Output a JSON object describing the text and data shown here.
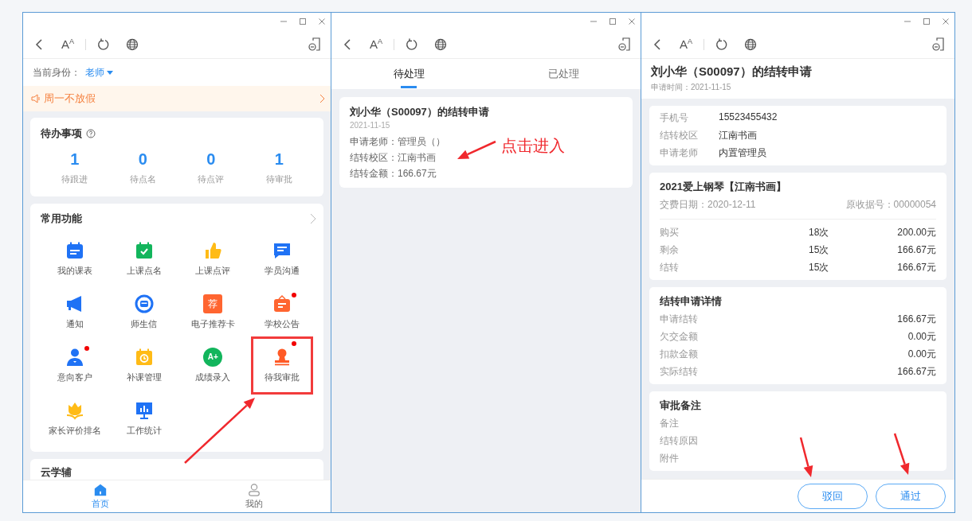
{
  "home_screen": {
    "toolbar": {
      "font_label": "A$^{A}$"
    },
    "identity": {
      "label": "当前身份：",
      "value": "老师"
    },
    "notice": "周一不放假",
    "todo": {
      "title": "待办事项",
      "items": [
        {
          "count": "1",
          "label": "待跟进"
        },
        {
          "count": "0",
          "label": "待点名"
        },
        {
          "count": "0",
          "label": "待点评"
        },
        {
          "count": "1",
          "label": "待审批"
        }
      ]
    },
    "functions": {
      "title": "常用功能",
      "items": [
        {
          "label": "我的课表",
          "kind": "calendar",
          "badge": false,
          "highlighted": false
        },
        {
          "label": "上课点名",
          "kind": "check-calendar",
          "badge": false,
          "highlighted": false
        },
        {
          "label": "上课点评",
          "kind": "thumb",
          "badge": false,
          "highlighted": false
        },
        {
          "label": "学员沟通",
          "kind": "chat",
          "badge": false,
          "highlighted": false
        },
        {
          "label": "通知",
          "kind": "megaphone",
          "badge": false,
          "highlighted": false
        },
        {
          "label": "师生信",
          "kind": "message",
          "badge": false,
          "highlighted": false
        },
        {
          "label": "电子推荐卡",
          "kind": "text-card",
          "icon_text": "荐",
          "badge": false,
          "highlighted": false
        },
        {
          "label": "学校公告",
          "kind": "board",
          "badge": true,
          "highlighted": false
        },
        {
          "label": "意向客户",
          "kind": "person",
          "badge": true,
          "highlighted": false
        },
        {
          "label": "补课管理",
          "kind": "clock-calendar",
          "badge": false,
          "highlighted": false
        },
        {
          "label": "成绩录入",
          "kind": "text-circle",
          "icon_text": "A+",
          "badge": false,
          "highlighted": false
        },
        {
          "label": "待我审批",
          "kind": "stamp",
          "badge": true,
          "highlighted": true
        },
        {
          "label": "家长评价排名",
          "kind": "tulip",
          "badge": false,
          "highlighted": false
        },
        {
          "label": "工作统计",
          "kind": "monitor",
          "badge": false,
          "highlighted": false
        }
      ]
    },
    "section_title": "云学辅",
    "bottom_nav": [
      {
        "label": "首页",
        "kind": "home",
        "selected": true
      },
      {
        "label": "我的",
        "kind": "user",
        "selected": false
      }
    ]
  },
  "approval_list_screen": {
    "toolbar": {
      "font_label": "A$^{A}$"
    },
    "tabs": [
      {
        "label": "待处理",
        "selected": true
      },
      {
        "label": "已处理",
        "selected": false
      }
    ],
    "card": {
      "title": "刘小华（S00097）的结转申请",
      "date": "2021-11-15",
      "lines": [
        "申请老师：管理员（）",
        "结转校区：江南书画",
        "结转金额：166.67元"
      ]
    },
    "annotation": "点击进入"
  },
  "detail_screen": {
    "toolbar": {
      "font_label": "A$^{A}$"
    },
    "title": "刘小华（S00097）的结转申请",
    "subtitle": "申请时间：2021-11-15",
    "info": [
      {
        "label": "手机号",
        "value": "15523455432"
      },
      {
        "label": "结转校区",
        "value": "江南书画"
      },
      {
        "label": "申请老师",
        "value": "内置管理员"
      }
    ],
    "course": {
      "title": "2021爱上钢琴【江南书画】",
      "date": "交费日期：2020-12-11",
      "receipt": "原收据号：00000054",
      "rows": [
        {
          "label": "购买",
          "count": "18次",
          "amount": "200.00元"
        },
        {
          "label": "剩余",
          "count": "15次",
          "amount": "166.67元"
        },
        {
          "label": "结转",
          "count": "15次",
          "amount": "166.67元"
        }
      ]
    },
    "details": {
      "title": "结转申请详情",
      "rows": [
        {
          "label": "申请结转",
          "value": "166.67元"
        },
        {
          "label": "欠交金额",
          "value": "0.00元"
        },
        {
          "label": "扣款金额",
          "value": "0.00元"
        },
        {
          "label": "实际结转",
          "value": "166.67元"
        }
      ]
    },
    "remarks": {
      "title": "审批备注",
      "rows": [
        "备注",
        "结转原因",
        "附件"
      ]
    },
    "buttons": [
      "驳回",
      "通过"
    ]
  }
}
